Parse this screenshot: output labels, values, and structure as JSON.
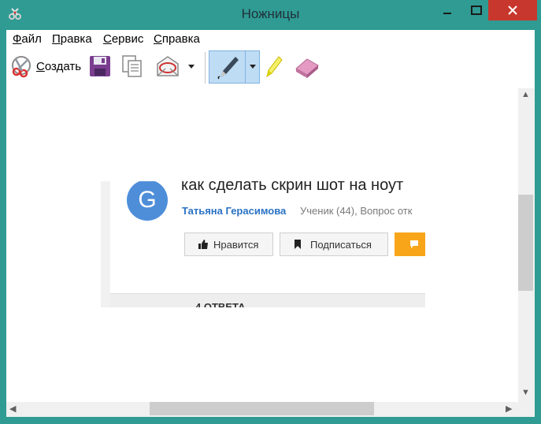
{
  "window": {
    "title": "Ножницы"
  },
  "menu": {
    "file": {
      "u": "Ф",
      "rest": "айл"
    },
    "edit": {
      "u": "П",
      "rest": "равка"
    },
    "service": {
      "u": "С",
      "rest": "ервис"
    },
    "help": {
      "u": "С",
      "rest": "правка"
    }
  },
  "toolbar": {
    "new": {
      "u": "С",
      "rest": "оздать"
    },
    "icons": [
      "scissors-icon",
      "save-icon",
      "copy-icon",
      "send-email-icon",
      "pen-icon",
      "highlighter-icon",
      "eraser-icon"
    ]
  },
  "snippet": {
    "avatar_letter": "G",
    "question_title": "как сделать скрин шот на ноут",
    "author": "Татьяна Герасимова",
    "meta": "Ученик (44), Вопрос отк",
    "like_label": "Нравится",
    "subscribe_label": "Подписаться",
    "answers_label": "4 ОТВЕТА",
    "colors": {
      "avatar": "#4e8ed9",
      "author": "#2a72c4",
      "orange": "#f8a51a"
    }
  },
  "colors": {
    "frame": "#2f9b93",
    "close": "#c8372d",
    "pen_active": "#bfdcf5"
  }
}
